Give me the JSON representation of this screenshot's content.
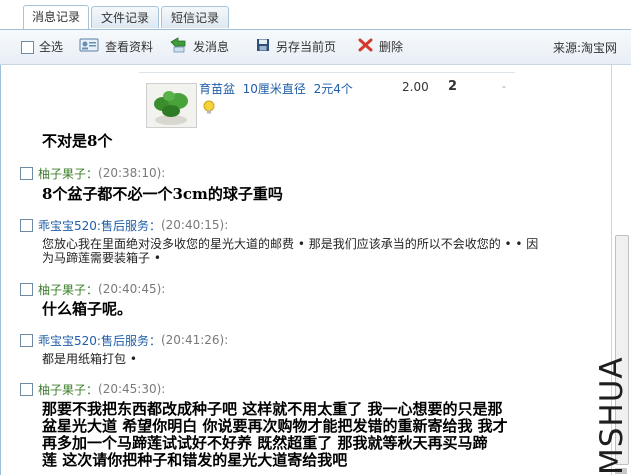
{
  "tabs": [
    {
      "label": "消息记录",
      "active": true
    },
    {
      "label": "文件记录",
      "active": false
    },
    {
      "label": "短信记录",
      "active": false
    }
  ],
  "toolbar": {
    "select_all": "全选",
    "view_profile": "查看资料",
    "send_message": "发消息",
    "save_page": "另存当前页",
    "delete": "删除",
    "source": "来源:淘宝网"
  },
  "product": {
    "name": "育苗盆",
    "spec": "10厘米直径",
    "price_note": "2元4个",
    "price": "2.00",
    "qty": "2",
    "dash": "-"
  },
  "messages": [
    {
      "text": "不对是8个"
    },
    {
      "sender": "柚子果子：",
      "time": "(20:38:10):",
      "text": "8个盆子都不必一个3cm的球子重吗"
    },
    {
      "sender": "乖宝宝520:售后服务：",
      "time": "(20:40:15):",
      "text_line1": "您放心我在里面绝对没多收您的星光大道的邮费 • 那是我们应该承当的所以不会收您的 • • 因",
      "text_line2": "为马蹄莲需要装箱子 •"
    },
    {
      "sender": "柚子果子：",
      "time": "(20:40:45):",
      "text": "什么箱子呢。"
    },
    {
      "sender": "乖宝宝520:售后服务：",
      "time": "(20:41:26):",
      "text": "都是用纸箱打包 •"
    },
    {
      "sender": "柚子果子：",
      "time": "(20:45:30):",
      "text_line1": "那要不我把东西都改成种子吧  这样就不用太重了  我一心想要的只是那",
      "text_line2": "盆星光大道  希望你明白  你说要再次购物才能把发错的重新寄给我  我才",
      "text_line3": "再多加一个马蹄莲试试好不好养  既然超重了  那我就等秋天再买马蹄",
      "text_line4": "莲  这次请你把种子和错发的星光大道寄给我吧"
    }
  ],
  "watermark": "MSHUA",
  "colors": {
    "sender_green": "#3c7f2b",
    "sender_blue": "#1f5ea8",
    "link": "#1f5ea8"
  }
}
